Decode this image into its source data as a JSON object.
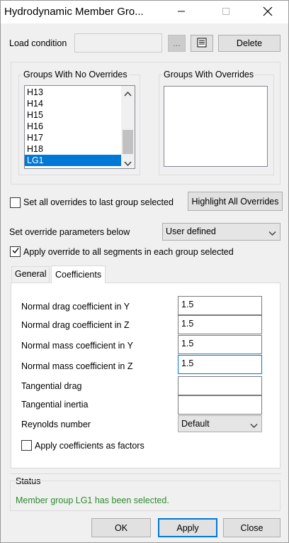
{
  "window": {
    "title": "Hydrodynamic Member Gro...",
    "minimize_icon": "minimize-icon",
    "maximize_icon": "maximize-icon",
    "close_icon": "close-icon"
  },
  "load_condition": {
    "label": "Load condition",
    "value": "",
    "browse_label": "...",
    "list_icon": "list-icon",
    "delete_label": "Delete"
  },
  "groups_no_overrides": {
    "title": "Groups With No Overrides",
    "items": [
      "H13",
      "H14",
      "H15",
      "H16",
      "H17",
      "H18",
      "LG1"
    ],
    "selected": "LG1"
  },
  "groups_with_overrides": {
    "title": "Groups With Overrides",
    "items": []
  },
  "set_all_overrides": {
    "label": "Set all overrides to last group selected",
    "checked": false
  },
  "highlight_button": "Highlight All Overrides",
  "override_params": {
    "label": "Set override parameters below",
    "value": "User defined"
  },
  "apply_all_segments": {
    "label": "Apply override to all segments in each group selected",
    "checked": true
  },
  "tabs": {
    "general": "General",
    "coefficients": "Coefficients",
    "active": "Coefficients"
  },
  "coefficients": {
    "normal_drag_y": {
      "label": "Normal drag coefficient in Y",
      "value": "1.5"
    },
    "normal_drag_z": {
      "label": "Normal drag coefficient in Z",
      "value": "1.5"
    },
    "normal_mass_y": {
      "label": "Normal mass coefficient in Y",
      "value": "1.5"
    },
    "normal_mass_z": {
      "label": "Normal mass coefficient in Z",
      "value": "1.5"
    },
    "tangential_drag": {
      "label": "Tangential drag",
      "value": ""
    },
    "tangential_inertia": {
      "label": "Tangential inertia",
      "value": ""
    },
    "reynolds": {
      "label": "Reynolds number",
      "value": "Default"
    },
    "apply_factors": {
      "label": "Apply coefficients as factors",
      "checked": false
    }
  },
  "status": {
    "title": "Status",
    "message": "Member group LG1 has been selected.",
    "color": "#2e8b2e"
  },
  "footer": {
    "ok": "OK",
    "apply": "Apply",
    "close": "Close"
  }
}
